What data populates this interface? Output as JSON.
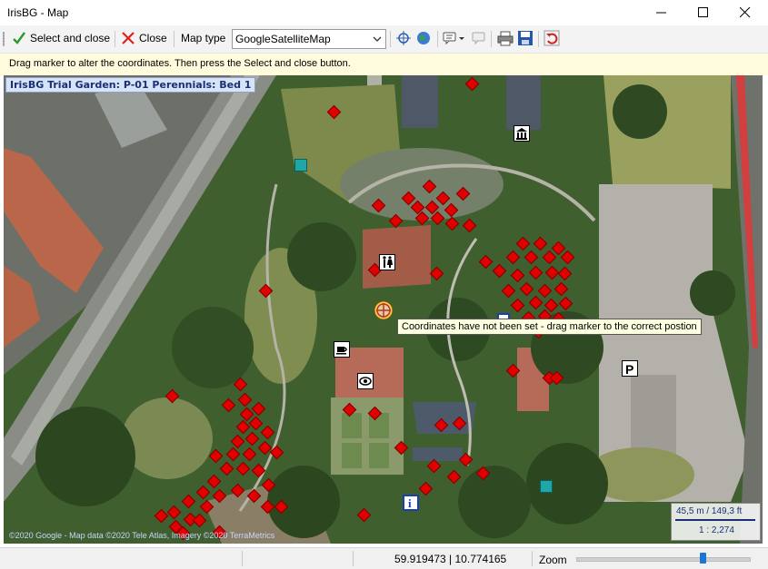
{
  "window": {
    "title": "IrisBG - Map"
  },
  "toolbar": {
    "select_close_label": "Select and close",
    "close_label": "Close",
    "map_type_label": "Map type",
    "map_type_value": "GoogleSatelliteMap"
  },
  "info": {
    "text": "Drag marker to alter the coordinates. Then press the Select and close button."
  },
  "map": {
    "location_label": "IrisBG Trial Garden: P-01 Perennials: Bed 1",
    "tooltip": "Coordinates have not been set - drag marker to the correct postion",
    "scale_text": "45,5 m / 149,3 ft",
    "scale_ratio": "1 : 2,274",
    "attribution": "©2020 Google - Map data ©2020 Tele Atlas, Imagery ©2020 TerraMetrics"
  },
  "status": {
    "coordinates": "59.919473 | 10.774165",
    "zoom_label": "Zoom",
    "zoom_level": 0.74
  },
  "colors": {
    "marker": "#e00000",
    "tooltip_bg": "#ffffe1",
    "slider_thumb": "#1976d2"
  }
}
